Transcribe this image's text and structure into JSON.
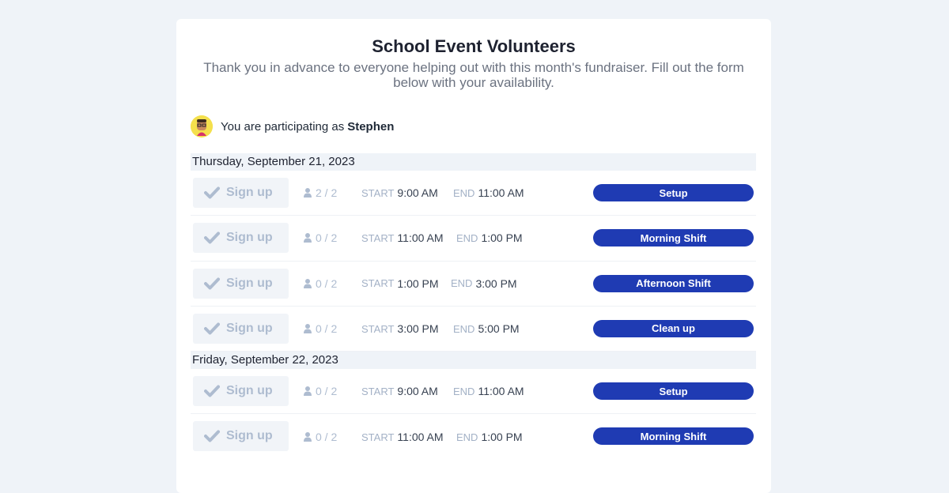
{
  "page": {
    "title": "School Event Volunteers",
    "description": "Thank you in advance to everyone helping out with this month's fundraiser. Fill out the form below with your availability."
  },
  "participant": {
    "prefix": "You are participating as",
    "name": "Stephen"
  },
  "labels": {
    "signup": "Sign up",
    "start": "START",
    "end": "END"
  },
  "colors": {
    "tag_bg": "#1f3bb3",
    "background": "#eff3f8"
  },
  "days": [
    {
      "date": "Thursday, September 21, 2023",
      "shifts": [
        {
          "slots": "2 / 2",
          "start": "9:00 AM",
          "end": "11:00 AM",
          "name": "Setup"
        },
        {
          "slots": "0 / 2",
          "start": "11:00 AM",
          "end": "1:00 PM",
          "name": "Morning Shift"
        },
        {
          "slots": "0 / 2",
          "start": "1:00 PM",
          "end": "3:00 PM",
          "name": "Afternoon Shift"
        },
        {
          "slots": "0 / 2",
          "start": "3:00 PM",
          "end": "5:00 PM",
          "name": "Clean up"
        }
      ]
    },
    {
      "date": "Friday, September 22, 2023",
      "shifts": [
        {
          "slots": "0 / 2",
          "start": "9:00 AM",
          "end": "11:00 AM",
          "name": "Setup"
        },
        {
          "slots": "0 / 2",
          "start": "11:00 AM",
          "end": "1:00 PM",
          "name": "Morning Shift"
        }
      ]
    }
  ]
}
